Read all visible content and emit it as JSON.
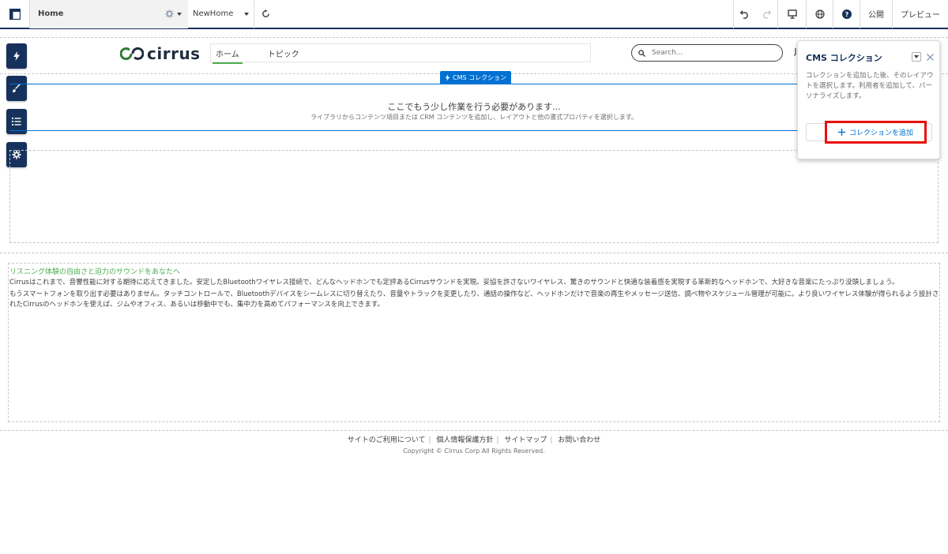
{
  "topbar": {
    "page_name": "Home",
    "page_variation": "NewHome",
    "publish_label": "公開",
    "preview_label": "プレビュー"
  },
  "site": {
    "logo_text": "cirrus",
    "nav": [
      {
        "label": "ホーム"
      },
      {
        "label": "トピック"
      }
    ],
    "search_placeholder": "Search..."
  },
  "cms_block": {
    "tag_label": "CMS コレクション",
    "placeholder_title": "ここでもう少し作業を行う必要があります...",
    "placeholder_sub": "ライブラリからコンテンツ項目または CRM コンテンツを追加し、レイアウトと他の書式プロパティを選択します。"
  },
  "richtext": {
    "heading": "リスニング体験の自由さと迫力のサウンドをあなたへ",
    "p1": "Cirrusはこれまで、音響性能に対する期待に応えてきました。安定したBluetoothワイヤレス接続で、どんなヘッドホンでも定評あるCirrusサウンドを実現。妥協を許さないワイヤレス、驚きのサウンドと快適な装着感を実現する革新的なヘッドホンで、大好きな音楽にたっぷり没頭しましょう。",
    "p2": "もうスマートフォンを取り出す必要はありません。タッチコントロールで、Bluetoothデバイスをシームレスに切り替えたり、音量やトラックを変更したり、通話の操作など、ヘッドホンだけで音楽の再生やメッセージ送信、調べ物やスケジュール管理が可能に。より良いワイヤレス体験が得られるよう設計されたCirrusのヘッドホンを使えば、ジムやオフィス、あるいは移動中でも、集中力を高めてパフォーマンスを向上できます。"
  },
  "footer": {
    "links": [
      "サイトのご利用について",
      "個人情報保護方針",
      "サイトマップ",
      "お問い合わせ"
    ],
    "copyright": "Copyright © Cirrus Corp All Rights Reserved."
  },
  "popover": {
    "title": "CMS コレクション",
    "description": "コレクションを追加した後、そのレイアウトを選択します。利用者を追加して、パーソナライズします。",
    "add_button": "コレクションを追加"
  },
  "colors": {
    "brand_navy": "#16325c",
    "link_blue": "#0070d2",
    "accent_green": "#4caf50",
    "highlight_red": "#e8100c"
  }
}
